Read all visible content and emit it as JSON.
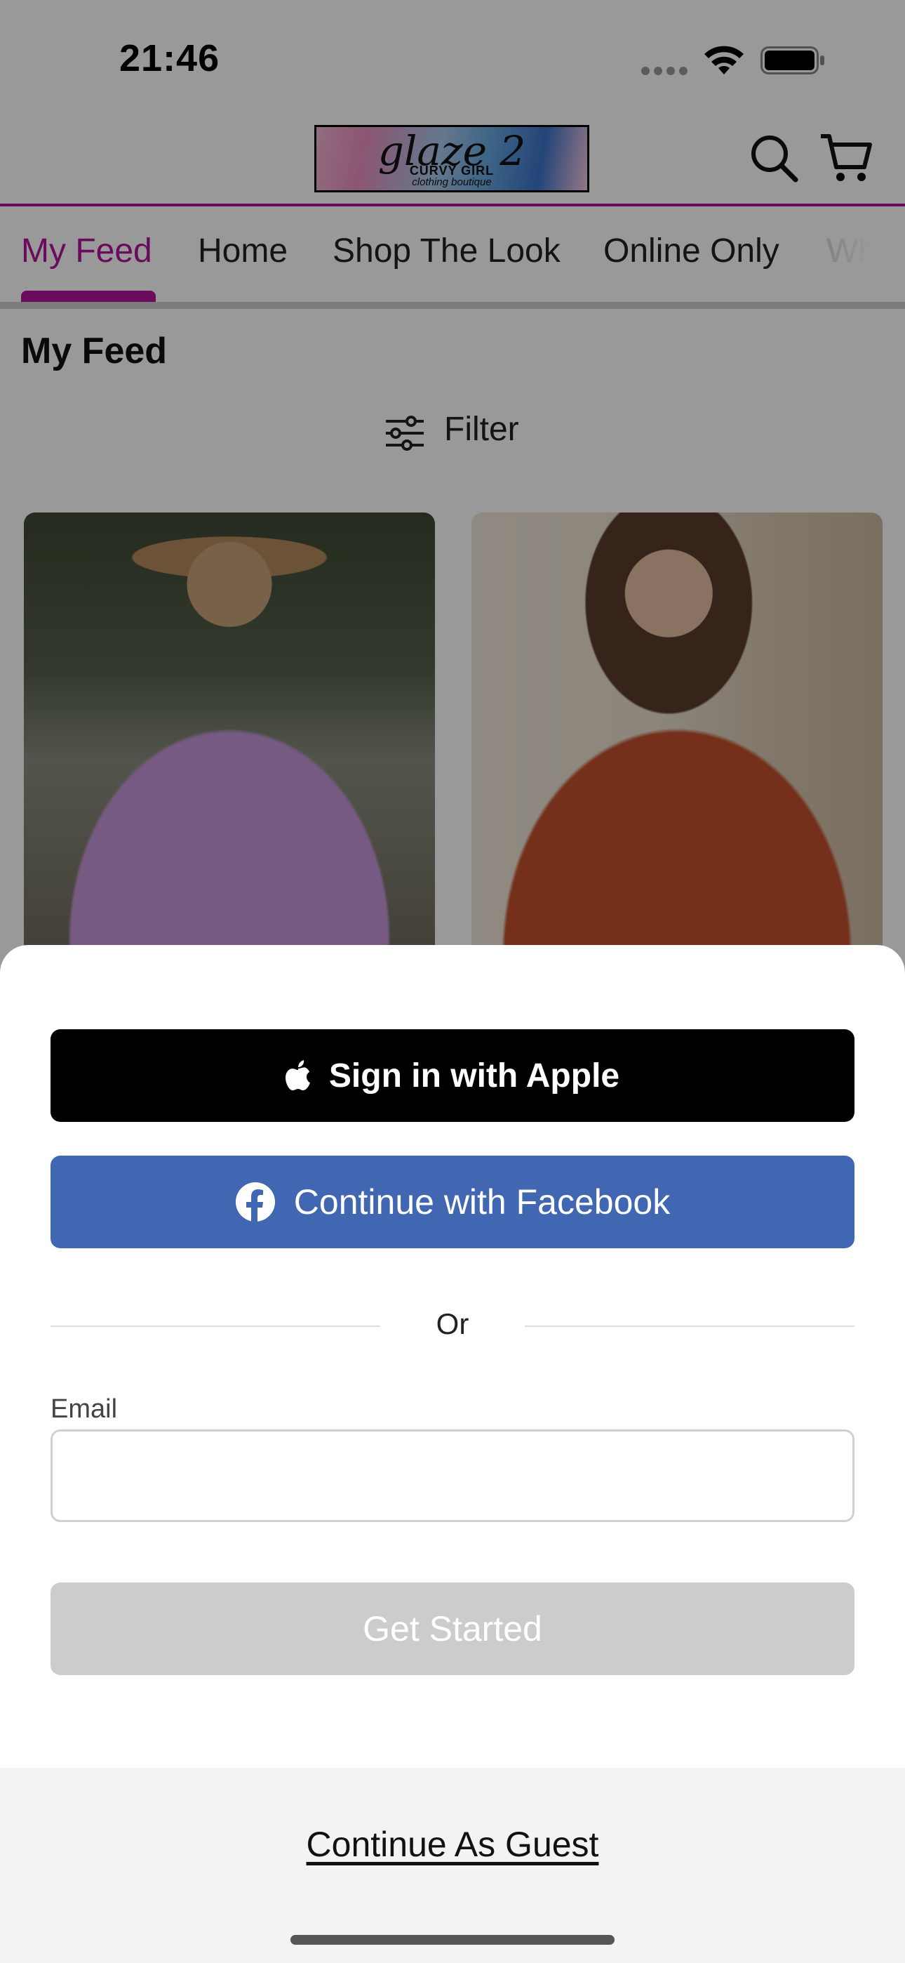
{
  "status_bar": {
    "time": "21:46"
  },
  "header": {
    "logo": {
      "main": "glaze 2",
      "sub": "CURVY GIRL",
      "sub2": "clothing boutique"
    },
    "search_icon": "search-icon",
    "cart_icon": "cart-icon"
  },
  "tabs": [
    "My Feed",
    "Home",
    "Shop The Look",
    "Online Only",
    "Wh"
  ],
  "active_tab": "My Feed",
  "feed": {
    "title": "My Feed",
    "filter_label": "Filter"
  },
  "products": [
    {
      "image": "woman in purple lace top with cowboy hat"
    },
    {
      "image": "woman in rust long-sleeve top"
    }
  ],
  "sheet": {
    "apple_button": "Sign in with Apple",
    "facebook_button": "Continue with Facebook",
    "or_text": "Or",
    "email_label": "Email",
    "email_value": "",
    "get_started_button": "Get Started",
    "guest_link": "Continue As Guest"
  },
  "colors": {
    "accent": "#b3139b",
    "facebook": "#4267b2",
    "disabled": "#cccccc"
  }
}
